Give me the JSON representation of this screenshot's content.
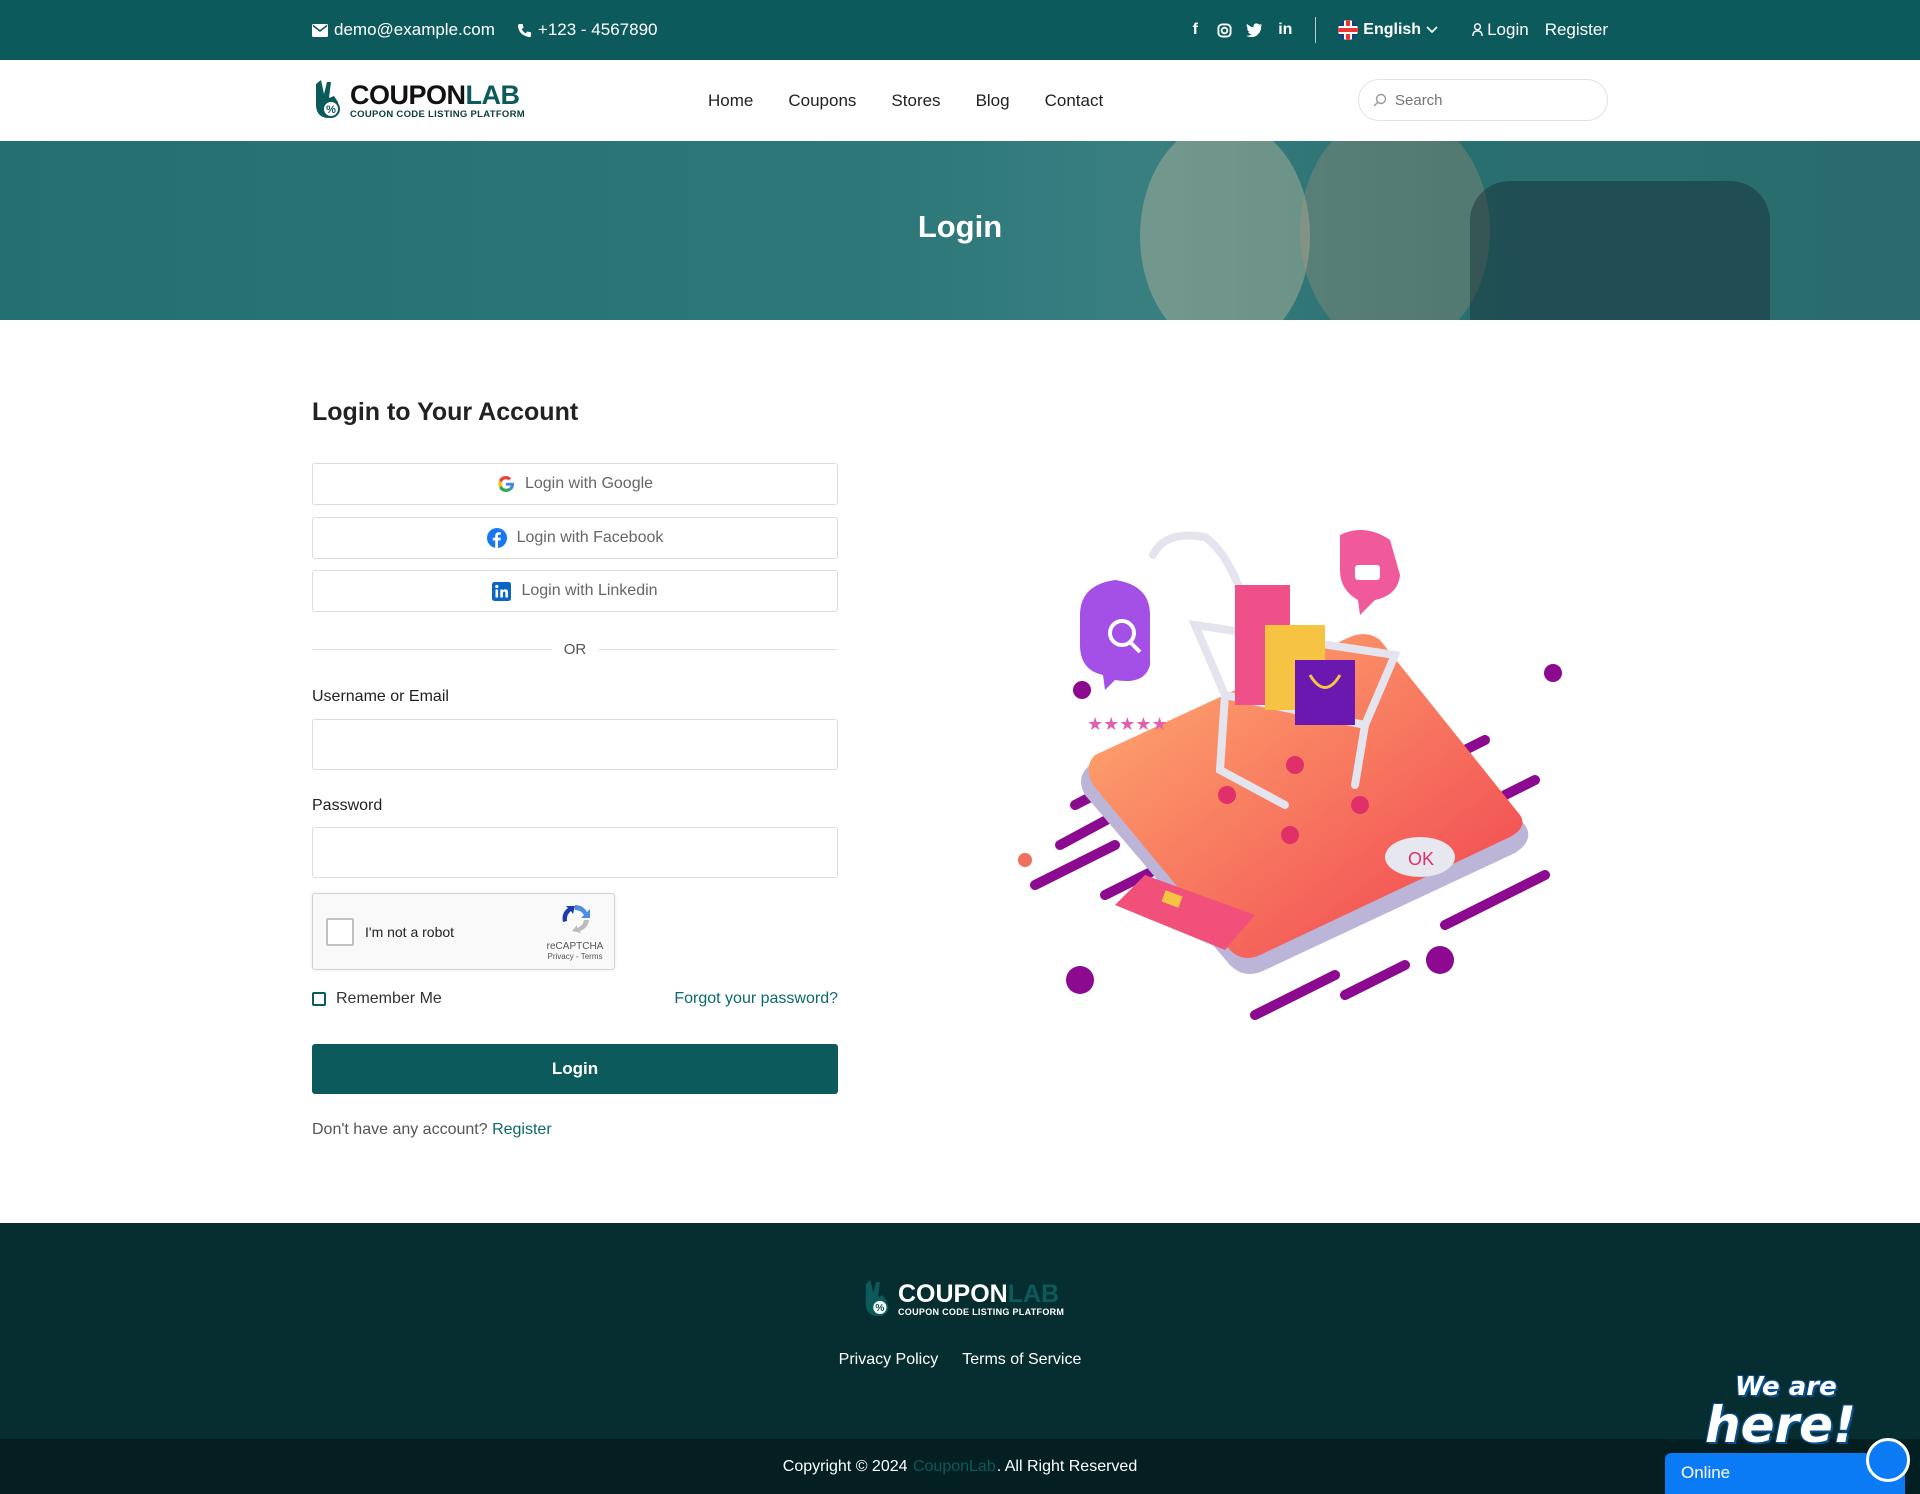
{
  "topbar": {
    "email": "demo@example.com",
    "phone": "+123 - 4567890",
    "social_icons": [
      "facebook-icon",
      "instagram-icon",
      "twitter-icon",
      "linkedin-icon"
    ],
    "language": "English",
    "login_label": "Login",
    "register_label": "Register",
    "bg_color": "#0c5a5c"
  },
  "brand": {
    "name_part1": "COUPON",
    "name_part2": "LAB",
    "tagline": "COUPON CODE LISTING PLATFORM"
  },
  "nav": {
    "items": [
      "Home",
      "Coupons",
      "Stores",
      "Blog",
      "Contact"
    ],
    "search_placeholder": "Search"
  },
  "hero": {
    "title": "Login"
  },
  "login": {
    "heading": "Login to Your Account",
    "google_label": "Login with Google",
    "facebook_label": "Login with Facebook",
    "linkedin_label": "Login with Linkedin",
    "or_text": "OR",
    "username_label": "Username or Email",
    "username_value": "",
    "password_label": "Password",
    "password_value": "",
    "captcha_text": "I'm not a robot",
    "captcha_brand": "reCAPTCHA",
    "captcha_links": "Privacy - Terms",
    "remember_label": "Remember Me",
    "forgot_label": "Forgot your password?",
    "submit_label": "Login",
    "no_account_text": "Don't have any account?",
    "register_link": "Register"
  },
  "footer": {
    "links": [
      "Privacy Policy",
      "Terms of Service"
    ],
    "copyright_prefix": "Copyright © 2024",
    "copyright_brand": "CouponLab",
    "copyright_suffix": ". All Right Reserved"
  },
  "chat": {
    "badge_line1": "We are",
    "badge_line2": "here!",
    "status": "Online"
  }
}
